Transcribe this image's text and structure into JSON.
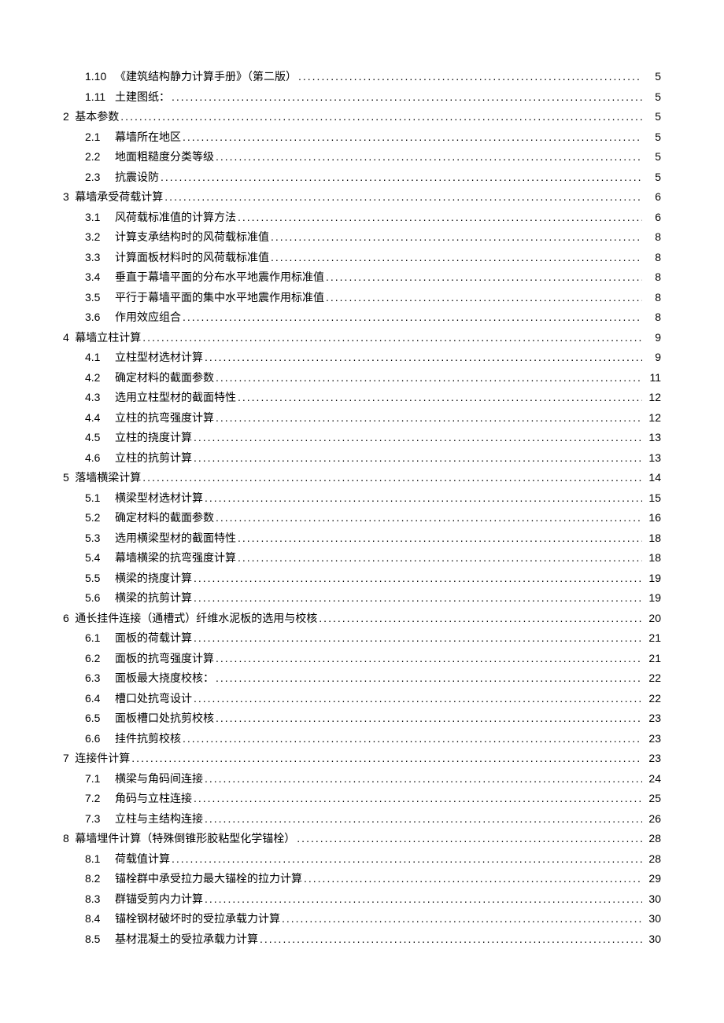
{
  "toc": [
    {
      "level": 2,
      "num": "1.10",
      "title": "《建筑结构静力计算手册》（第二版）",
      "page": "5"
    },
    {
      "level": 2,
      "num": "1.11",
      "title": "土建图纸：",
      "page": "5"
    },
    {
      "level": 1,
      "num": "2",
      "title": "基本参数",
      "page": "5"
    },
    {
      "level": 2,
      "num": "2.1",
      "title": "幕墙所在地区",
      "page": "5"
    },
    {
      "level": 2,
      "num": "2.2",
      "title": "地面粗糙度分类等级",
      "page": "5"
    },
    {
      "level": 2,
      "num": "2.3",
      "title": "抗震设防",
      "page": "5"
    },
    {
      "level": 1,
      "num": "3",
      "title": "幕墙承受荷载计算",
      "page": "6"
    },
    {
      "level": 2,
      "num": "3.1",
      "title": "风荷载标准值的计算方法",
      "page": "6"
    },
    {
      "level": 2,
      "num": "3.2",
      "title": "计算支承结构时的风荷载标准值",
      "page": "8"
    },
    {
      "level": 2,
      "num": "3.3",
      "title": "计算面板材料时的风荷载标准值",
      "page": "8"
    },
    {
      "level": 2,
      "num": "3.4",
      "title": "垂直于幕墙平面的分布水平地震作用标准值",
      "page": "8"
    },
    {
      "level": 2,
      "num": "3.5",
      "title": "平行于幕墙平面的集中水平地震作用标准值",
      "page": "8"
    },
    {
      "level": 2,
      "num": "3.6",
      "title": "作用效应组合",
      "page": "8"
    },
    {
      "level": 1,
      "num": "4",
      "title": "幕墙立柱计算",
      "page": "9"
    },
    {
      "level": 2,
      "num": "4.1",
      "title": "立柱型材选材计算",
      "page": "9"
    },
    {
      "level": 2,
      "num": "4.2",
      "title": "确定材料的截面参数",
      "page": "11"
    },
    {
      "level": 2,
      "num": "4.3",
      "title": "选用立柱型材的截面特性",
      "page": "12"
    },
    {
      "level": 2,
      "num": "4.4",
      "title": "立柱的抗弯强度计算",
      "page": "12"
    },
    {
      "level": 2,
      "num": "4.5",
      "title": "立柱的挠度计算",
      "page": "13"
    },
    {
      "level": 2,
      "num": "4.6",
      "title": "立柱的抗剪计算",
      "page": "13"
    },
    {
      "level": 1,
      "num": "5",
      "title": "落墙横梁计算",
      "page": "14"
    },
    {
      "level": 2,
      "num": "5.1",
      "title": "横梁型材选材计算",
      "page": "15"
    },
    {
      "level": 2,
      "num": "5.2",
      "title": "确定材料的截面参数",
      "page": "16"
    },
    {
      "level": 2,
      "num": "5.3",
      "title": "选用横梁型材的截面特性",
      "page": "18"
    },
    {
      "level": 2,
      "num": "5.4",
      "title": "幕墙横梁的抗弯强度计算",
      "page": "18"
    },
    {
      "level": 2,
      "num": "5.5",
      "title": "横梁的挠度计算",
      "page": "19"
    },
    {
      "level": 2,
      "num": "5.6",
      "title": "横梁的抗剪计算",
      "page": "19"
    },
    {
      "level": 1,
      "num": "6",
      "title": "通长挂件连接（通槽式）纤维水泥板的选用与校核",
      "page": "20"
    },
    {
      "level": 2,
      "num": "6.1",
      "title": "面板的荷载计算",
      "page": "21"
    },
    {
      "level": 2,
      "num": "6.2",
      "title": "面板的抗弯强度计算",
      "page": "21"
    },
    {
      "level": 2,
      "num": "6.3",
      "title": "面板最大挠度校核：",
      "page": "22"
    },
    {
      "level": 2,
      "num": "6.4",
      "title": "槽口处抗弯设计",
      "page": "22"
    },
    {
      "level": 2,
      "num": "6.5",
      "title": "面板槽口处抗剪校核",
      "page": "23"
    },
    {
      "level": 2,
      "num": "6.6",
      "title": "挂件抗剪校核",
      "page": "23"
    },
    {
      "level": 1,
      "num": "7",
      "title": "连接件计算",
      "page": "23"
    },
    {
      "level": 2,
      "num": "7.1",
      "title": "横梁与角码间连接",
      "page": "24"
    },
    {
      "level": 2,
      "num": "7.2",
      "title": "角码与立柱连接",
      "page": "25"
    },
    {
      "level": 2,
      "num": "7.3",
      "title": "立柱与主结构连接",
      "page": "26"
    },
    {
      "level": 1,
      "num": "8",
      "title": "幕墙埋件计算（特殊倒锥形胶粘型化学锚栓）",
      "page": "28"
    },
    {
      "level": 2,
      "num": "8.1",
      "title": "荷载值计算",
      "page": "28"
    },
    {
      "level": 2,
      "num": "8.2",
      "title": "锚栓群中承受拉力最大锚栓的拉力计算",
      "page": "29"
    },
    {
      "level": 2,
      "num": "8.3",
      "title": "群锚受剪内力计算",
      "page": "30"
    },
    {
      "level": 2,
      "num": "8.4",
      "title": "锚栓钢材破坏时的受拉承载力计算",
      "page": "30"
    },
    {
      "level": 2,
      "num": "8.5",
      "title": "基材混凝土的受拉承载力计算",
      "page": "30"
    }
  ]
}
